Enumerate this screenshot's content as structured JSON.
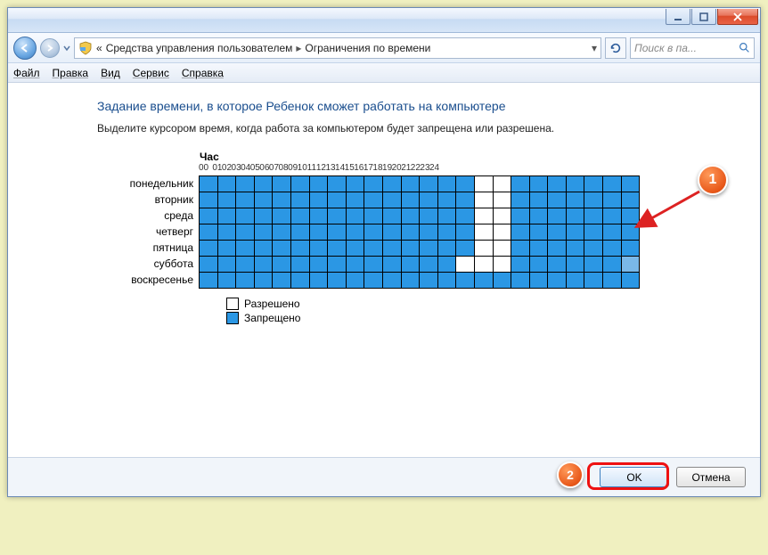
{
  "window": {
    "min_tip": "Свернуть",
    "max_tip": "Развернуть",
    "close_tip": "Закрыть"
  },
  "nav": {
    "back_tip": "Назад",
    "fwd_tip": "Вперёд",
    "breadcrumb_prefix": "«",
    "breadcrumb1": "Средства управления пользователем",
    "breadcrumb2": "Ограничения по времени",
    "refresh_tip": "Обновить",
    "search_placeholder": "Поиск в па..."
  },
  "menu": {
    "file": "Файл",
    "edit": "Правка",
    "view": "Вид",
    "tools": "Сервис",
    "help": "Справка"
  },
  "main": {
    "title": "Задание времени, в которое Ребенок сможет работать на компьютере",
    "subtitle": "Выделите курсором время, когда работа за компьютером будет запрещена или разрешена.",
    "hour_label": "Час",
    "hours": [
      "00",
      "01",
      "02",
      "03",
      "04",
      "05",
      "06",
      "07",
      "08",
      "09",
      "10",
      "11",
      "12",
      "13",
      "14",
      "15",
      "16",
      "17",
      "18",
      "19",
      "20",
      "21",
      "22",
      "23",
      "24"
    ],
    "days": [
      "понедельник",
      "вторник",
      "среда",
      "четверг",
      "пятница",
      "суббота",
      "воскресенье"
    ],
    "schedule": [
      [
        1,
        1,
        1,
        1,
        1,
        1,
        1,
        1,
        1,
        1,
        1,
        1,
        1,
        1,
        1,
        0,
        0,
        1,
        1,
        1,
        1,
        1,
        1,
        1
      ],
      [
        1,
        1,
        1,
        1,
        1,
        1,
        1,
        1,
        1,
        1,
        1,
        1,
        1,
        1,
        1,
        0,
        0,
        1,
        1,
        1,
        1,
        1,
        1,
        1
      ],
      [
        1,
        1,
        1,
        1,
        1,
        1,
        1,
        1,
        1,
        1,
        1,
        1,
        1,
        1,
        1,
        0,
        0,
        1,
        1,
        1,
        1,
        1,
        1,
        1
      ],
      [
        1,
        1,
        1,
        1,
        1,
        1,
        1,
        1,
        1,
        1,
        1,
        1,
        1,
        1,
        1,
        0,
        0,
        1,
        1,
        1,
        1,
        1,
        1,
        1
      ],
      [
        1,
        1,
        1,
        1,
        1,
        1,
        1,
        1,
        1,
        1,
        1,
        1,
        1,
        1,
        1,
        0,
        0,
        1,
        1,
        1,
        1,
        1,
        1,
        1
      ],
      [
        1,
        1,
        1,
        1,
        1,
        1,
        1,
        1,
        1,
        1,
        1,
        1,
        1,
        1,
        0,
        0,
        0,
        1,
        1,
        1,
        1,
        1,
        1,
        2
      ],
      [
        1,
        1,
        1,
        1,
        1,
        1,
        1,
        1,
        1,
        1,
        1,
        1,
        1,
        1,
        1,
        1,
        1,
        1,
        1,
        1,
        1,
        1,
        1,
        1
      ]
    ],
    "legend": {
      "allowed": "Разрешено",
      "blocked": "Запрещено"
    }
  },
  "buttons": {
    "ok": "OK",
    "cancel": "Отмена"
  },
  "callouts": {
    "c1": "1",
    "c2": "2"
  }
}
